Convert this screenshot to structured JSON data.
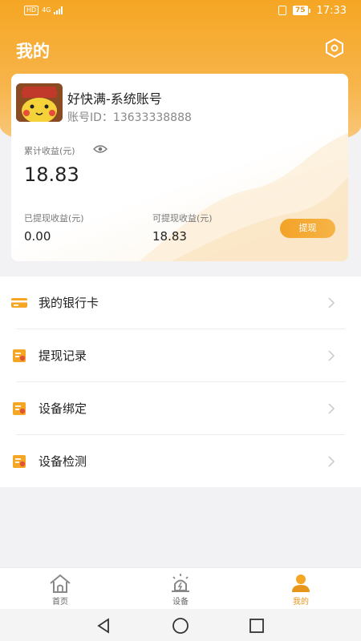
{
  "status_bar": {
    "hd_label": "HD",
    "network_label": "4G",
    "battery_level": "75",
    "time": "17:33"
  },
  "header": {
    "title": "我的",
    "settings_icon": "settings-hexagon-icon"
  },
  "profile": {
    "name": "好快满-系统账号",
    "account_id": "账号ID：13633338888"
  },
  "earnings": {
    "total_label": "累计收益(元)",
    "total_value": "18.83",
    "withdrawn_label": "已提现收益(元)",
    "withdrawn_value": "0.00",
    "available_label": "可提现收益(元)",
    "available_value": "18.83",
    "withdraw_button": "提现"
  },
  "menu": {
    "items": [
      {
        "label": "我的银行卡",
        "icon": "bank-card-icon"
      },
      {
        "label": "提现记录",
        "icon": "withdraw-record-icon"
      },
      {
        "label": "设备绑定",
        "icon": "device-bind-icon"
      },
      {
        "label": "设备检测",
        "icon": "device-check-icon"
      }
    ]
  },
  "tabs": [
    {
      "label": "首页",
      "icon": "home-icon",
      "active": false
    },
    {
      "label": "设备",
      "icon": "device-icon",
      "active": false
    },
    {
      "label": "我的",
      "icon": "user-icon",
      "active": true
    }
  ],
  "colors": {
    "accent": "#F5A623",
    "accent_dark": "#E8951C",
    "icon_red": "#E0533A"
  }
}
